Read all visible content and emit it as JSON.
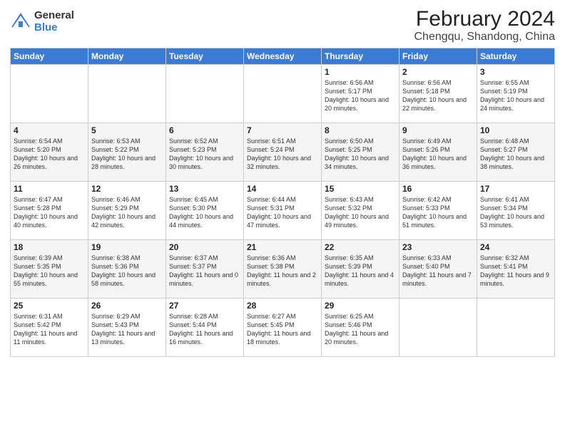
{
  "logo": {
    "general": "General",
    "blue": "Blue"
  },
  "title": "February 2024",
  "subtitle": "Chengqu, Shandong, China",
  "weekdays": [
    "Sunday",
    "Monday",
    "Tuesday",
    "Wednesday",
    "Thursday",
    "Friday",
    "Saturday"
  ],
  "weeks": [
    [
      {
        "day": "",
        "info": ""
      },
      {
        "day": "",
        "info": ""
      },
      {
        "day": "",
        "info": ""
      },
      {
        "day": "",
        "info": ""
      },
      {
        "day": "1",
        "info": "Sunrise: 6:56 AM\nSunset: 5:17 PM\nDaylight: 10 hours and 20 minutes."
      },
      {
        "day": "2",
        "info": "Sunrise: 6:56 AM\nSunset: 5:18 PM\nDaylight: 10 hours and 22 minutes."
      },
      {
        "day": "3",
        "info": "Sunrise: 6:55 AM\nSunset: 5:19 PM\nDaylight: 10 hours and 24 minutes."
      }
    ],
    [
      {
        "day": "4",
        "info": "Sunrise: 6:54 AM\nSunset: 5:20 PM\nDaylight: 10 hours and 26 minutes."
      },
      {
        "day": "5",
        "info": "Sunrise: 6:53 AM\nSunset: 5:22 PM\nDaylight: 10 hours and 28 minutes."
      },
      {
        "day": "6",
        "info": "Sunrise: 6:52 AM\nSunset: 5:23 PM\nDaylight: 10 hours and 30 minutes."
      },
      {
        "day": "7",
        "info": "Sunrise: 6:51 AM\nSunset: 5:24 PM\nDaylight: 10 hours and 32 minutes."
      },
      {
        "day": "8",
        "info": "Sunrise: 6:50 AM\nSunset: 5:25 PM\nDaylight: 10 hours and 34 minutes."
      },
      {
        "day": "9",
        "info": "Sunrise: 6:49 AM\nSunset: 5:26 PM\nDaylight: 10 hours and 36 minutes."
      },
      {
        "day": "10",
        "info": "Sunrise: 6:48 AM\nSunset: 5:27 PM\nDaylight: 10 hours and 38 minutes."
      }
    ],
    [
      {
        "day": "11",
        "info": "Sunrise: 6:47 AM\nSunset: 5:28 PM\nDaylight: 10 hours and 40 minutes."
      },
      {
        "day": "12",
        "info": "Sunrise: 6:46 AM\nSunset: 5:29 PM\nDaylight: 10 hours and 42 minutes."
      },
      {
        "day": "13",
        "info": "Sunrise: 6:45 AM\nSunset: 5:30 PM\nDaylight: 10 hours and 44 minutes."
      },
      {
        "day": "14",
        "info": "Sunrise: 6:44 AM\nSunset: 5:31 PM\nDaylight: 10 hours and 47 minutes."
      },
      {
        "day": "15",
        "info": "Sunrise: 6:43 AM\nSunset: 5:32 PM\nDaylight: 10 hours and 49 minutes."
      },
      {
        "day": "16",
        "info": "Sunrise: 6:42 AM\nSunset: 5:33 PM\nDaylight: 10 hours and 51 minutes."
      },
      {
        "day": "17",
        "info": "Sunrise: 6:41 AM\nSunset: 5:34 PM\nDaylight: 10 hours and 53 minutes."
      }
    ],
    [
      {
        "day": "18",
        "info": "Sunrise: 6:39 AM\nSunset: 5:35 PM\nDaylight: 10 hours and 55 minutes."
      },
      {
        "day": "19",
        "info": "Sunrise: 6:38 AM\nSunset: 5:36 PM\nDaylight: 10 hours and 58 minutes."
      },
      {
        "day": "20",
        "info": "Sunrise: 6:37 AM\nSunset: 5:37 PM\nDaylight: 11 hours and 0 minutes."
      },
      {
        "day": "21",
        "info": "Sunrise: 6:36 AM\nSunset: 5:38 PM\nDaylight: 11 hours and 2 minutes."
      },
      {
        "day": "22",
        "info": "Sunrise: 6:35 AM\nSunset: 5:39 PM\nDaylight: 11 hours and 4 minutes."
      },
      {
        "day": "23",
        "info": "Sunrise: 6:33 AM\nSunset: 5:40 PM\nDaylight: 11 hours and 7 minutes."
      },
      {
        "day": "24",
        "info": "Sunrise: 6:32 AM\nSunset: 5:41 PM\nDaylight: 11 hours and 9 minutes."
      }
    ],
    [
      {
        "day": "25",
        "info": "Sunrise: 6:31 AM\nSunset: 5:42 PM\nDaylight: 11 hours and 11 minutes."
      },
      {
        "day": "26",
        "info": "Sunrise: 6:29 AM\nSunset: 5:43 PM\nDaylight: 11 hours and 13 minutes."
      },
      {
        "day": "27",
        "info": "Sunrise: 6:28 AM\nSunset: 5:44 PM\nDaylight: 11 hours and 16 minutes."
      },
      {
        "day": "28",
        "info": "Sunrise: 6:27 AM\nSunset: 5:45 PM\nDaylight: 11 hours and 18 minutes."
      },
      {
        "day": "29",
        "info": "Sunrise: 6:25 AM\nSunset: 5:46 PM\nDaylight: 11 hours and 20 minutes."
      },
      {
        "day": "",
        "info": ""
      },
      {
        "day": "",
        "info": ""
      }
    ]
  ]
}
